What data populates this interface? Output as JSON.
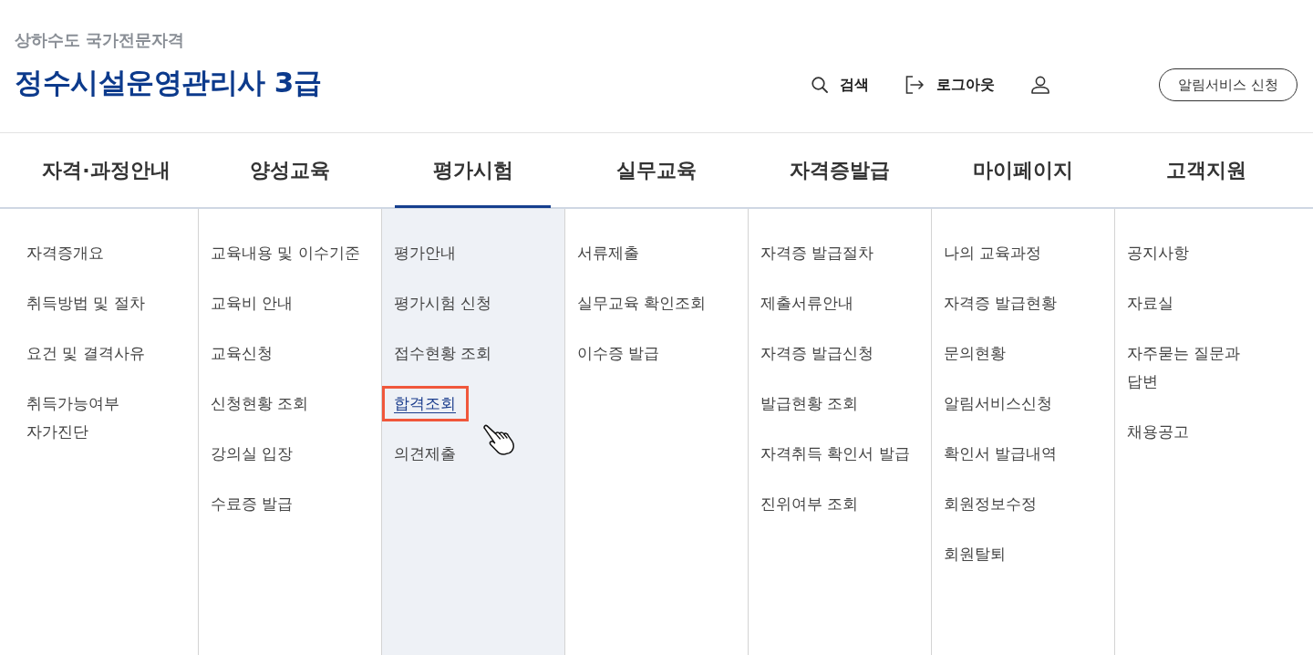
{
  "header": {
    "subtitle": "상하수도 국가전문자격",
    "title": "정수시설운영관리사 3급",
    "utilities": [
      {
        "kind": "search",
        "label": "검색"
      },
      {
        "kind": "logout",
        "label": "로그아웃"
      },
      {
        "kind": "user"
      }
    ],
    "alert_button": "알림서비스 신청"
  },
  "nav": {
    "tabs": [
      {
        "label": "자격·과정안내",
        "selected": false,
        "items": [
          {
            "label": "자격증개요",
            "selected": false
          },
          {
            "label": "취득방법 및 절차",
            "selected": false
          },
          {
            "label": "요건 및 결격사유",
            "selected": false
          },
          {
            "label": "취득가능여부\n자가진단",
            "selected": false
          }
        ]
      },
      {
        "label": "양성교육",
        "selected": false,
        "items": [
          {
            "label": "교육내용 및 이수기준",
            "selected": false
          },
          {
            "label": "교육비 안내",
            "selected": false
          },
          {
            "label": "교육신청",
            "selected": false
          },
          {
            "label": "신청현황 조회",
            "selected": false
          },
          {
            "label": "강의실 입장",
            "selected": false
          },
          {
            "label": "수료증 발급",
            "selected": false
          }
        ]
      },
      {
        "label": "평가시험",
        "selected": true,
        "items": [
          {
            "label": "평가안내",
            "selected": false
          },
          {
            "label": "평가시험 신청",
            "selected": false
          },
          {
            "label": "접수현황 조회",
            "selected": false
          },
          {
            "label": "합격조회",
            "selected": true
          },
          {
            "label": "의견제출",
            "selected": false
          }
        ]
      },
      {
        "label": "실무교육",
        "selected": false,
        "items": [
          {
            "label": "서류제출",
            "selected": false
          },
          {
            "label": "실무교육 확인조회",
            "selected": false
          },
          {
            "label": "이수증 발급",
            "selected": false
          }
        ]
      },
      {
        "label": "자격증발급",
        "selected": false,
        "items": [
          {
            "label": "자격증 발급절차",
            "selected": false
          },
          {
            "label": "제출서류안내",
            "selected": false
          },
          {
            "label": "자격증 발급신청",
            "selected": false
          },
          {
            "label": "발급현황 조회",
            "selected": false
          },
          {
            "label": "자격취득 확인서 발급",
            "selected": false
          },
          {
            "label": "진위여부 조회",
            "selected": false
          }
        ]
      },
      {
        "label": "마이페이지",
        "selected": false,
        "items": [
          {
            "label": "나의 교육과정",
            "selected": false
          },
          {
            "label": "자격증 발급현황",
            "selected": false
          },
          {
            "label": "문의현황",
            "selected": false
          },
          {
            "label": "알림서비스신청",
            "selected": false
          },
          {
            "label": "확인서 발급내역",
            "selected": false
          },
          {
            "label": "회원정보수정",
            "selected": false
          },
          {
            "label": "회원탈퇴",
            "selected": false
          }
        ]
      },
      {
        "label": "고객지원",
        "selected": false,
        "items": [
          {
            "label": "공지사항",
            "selected": false
          },
          {
            "label": "자료실",
            "selected": false
          },
          {
            "label": "자주묻는 질문과\n답변",
            "selected": false
          },
          {
            "label": "채용공고",
            "selected": false
          }
        ]
      }
    ]
  }
}
